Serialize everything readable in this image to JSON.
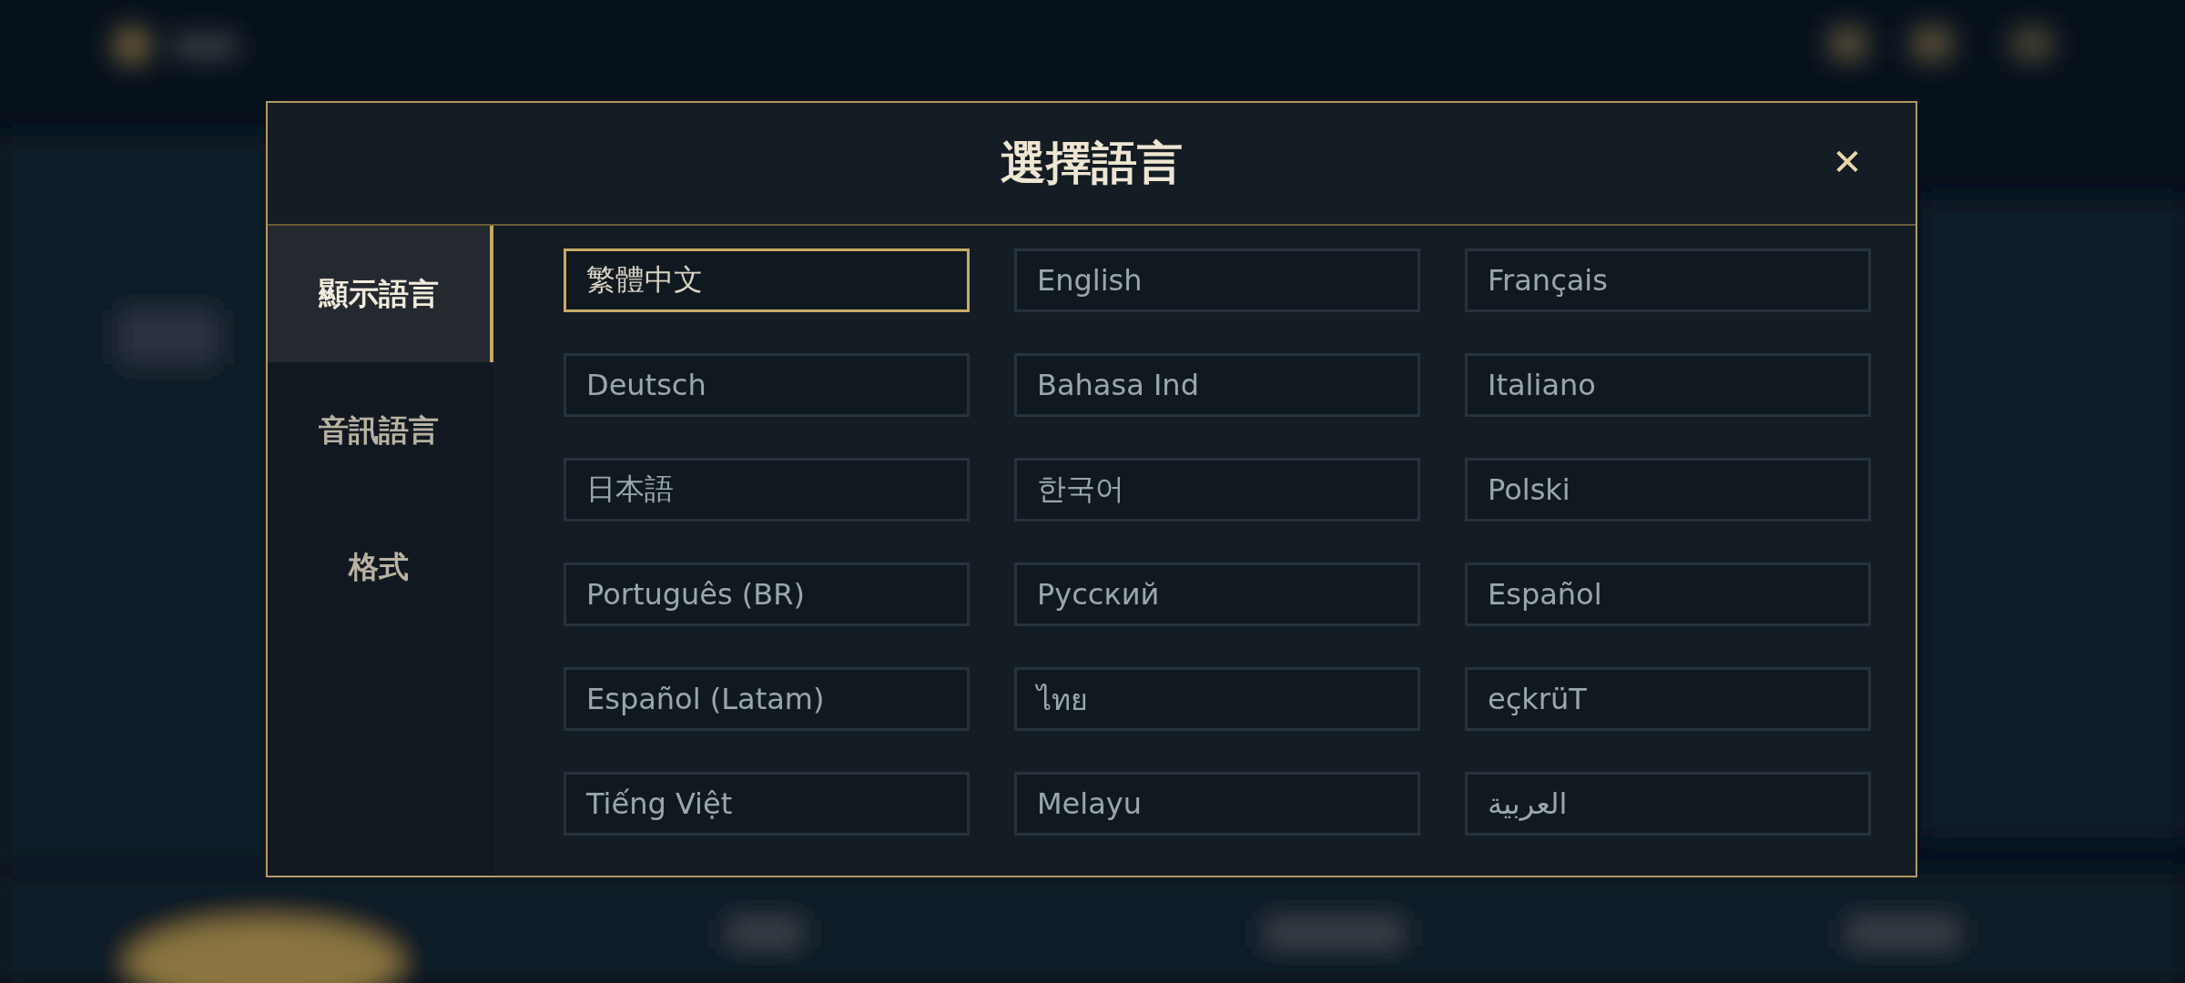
{
  "dialog": {
    "title": "選擇語言",
    "close": "✕"
  },
  "tabs": [
    {
      "label": "顯示語言",
      "selected": true
    },
    {
      "label": "音訊語言",
      "selected": false
    },
    {
      "label": "格式",
      "selected": false
    }
  ],
  "languages": [
    {
      "label": "繁體中文",
      "selected": true
    },
    {
      "label": "English",
      "selected": false
    },
    {
      "label": "Français",
      "selected": false
    },
    {
      "label": "Deutsch",
      "selected": false
    },
    {
      "label": "Bahasa Ind",
      "selected": false
    },
    {
      "label": "Italiano",
      "selected": false
    },
    {
      "label": "日本語",
      "selected": false
    },
    {
      "label": "한국어",
      "selected": false
    },
    {
      "label": "Polski",
      "selected": false
    },
    {
      "label": "Português (BR)",
      "selected": false
    },
    {
      "label": "Русский",
      "selected": false
    },
    {
      "label": "Español",
      "selected": false
    },
    {
      "label": "Español (Latam)",
      "selected": false
    },
    {
      "label": "ไทย",
      "selected": false
    },
    {
      "label": "eçkrüT",
      "selected": false
    },
    {
      "label": "Tiếng Việt",
      "selected": false
    },
    {
      "label": "Melayu",
      "selected": false
    },
    {
      "label": "العربية",
      "selected": false
    }
  ]
}
